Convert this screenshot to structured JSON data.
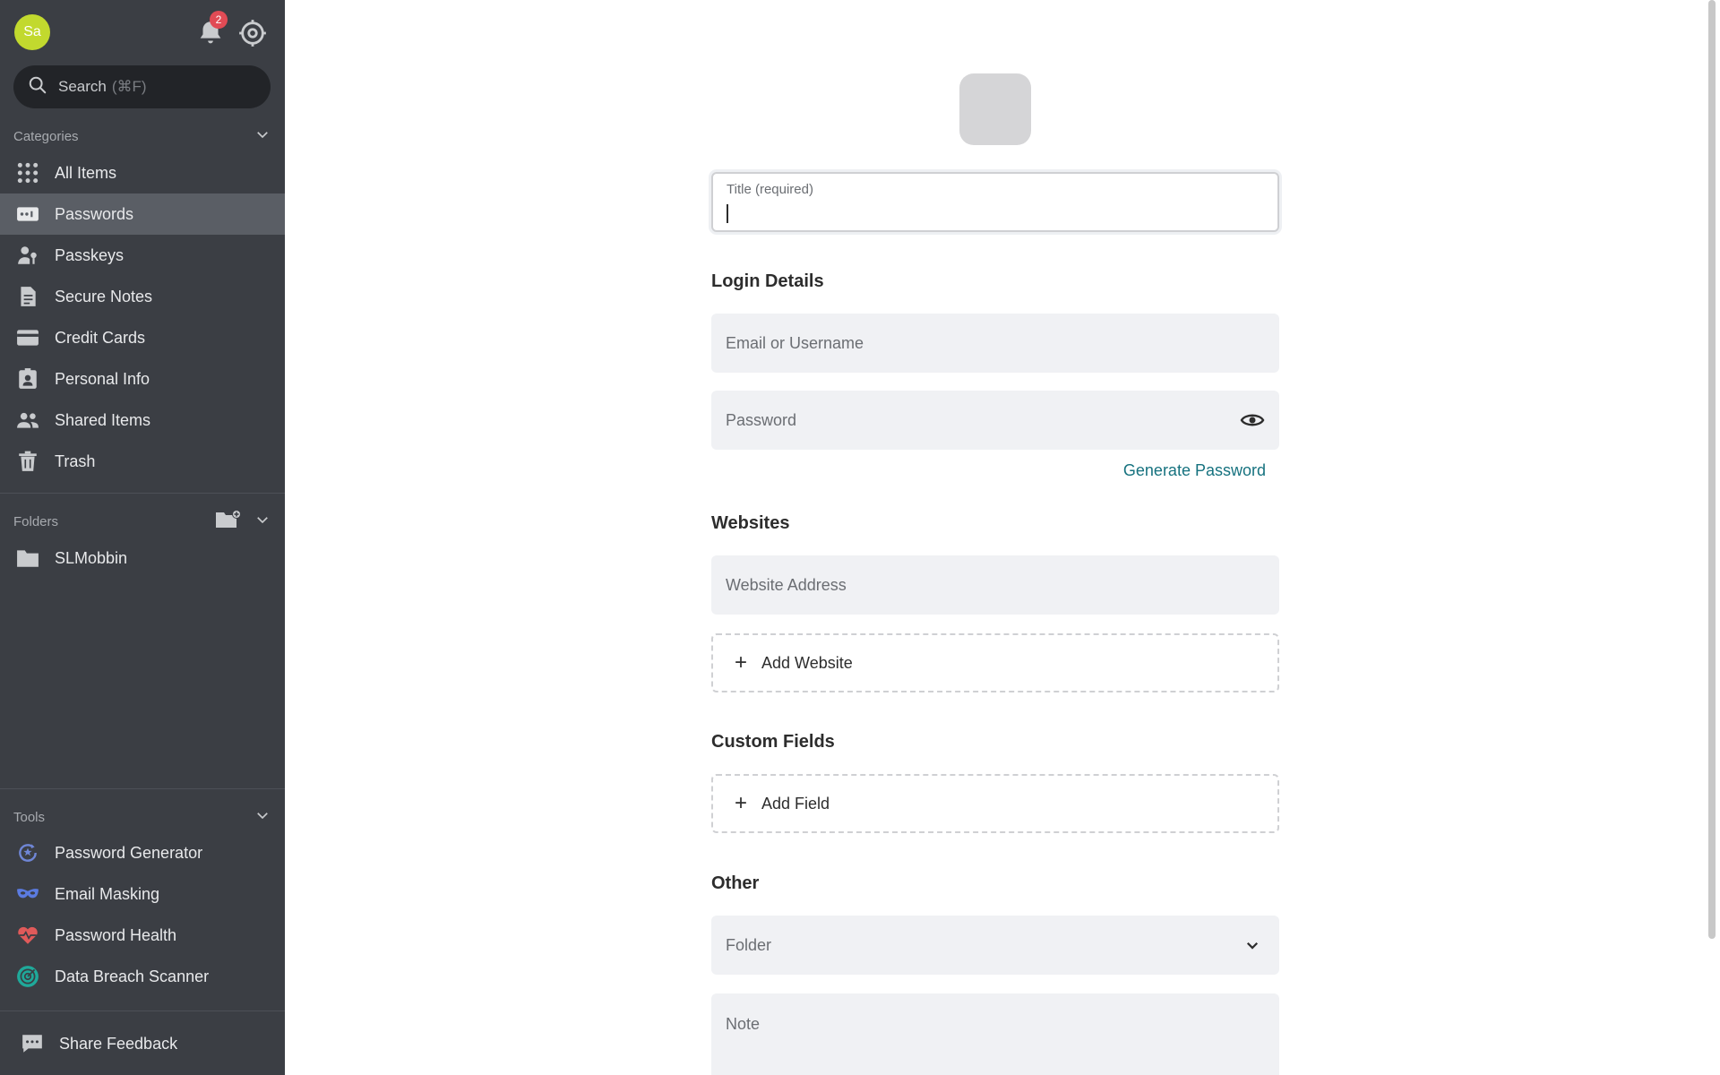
{
  "user": {
    "initials": "Sa",
    "notification_count": "2"
  },
  "search": {
    "placeholder": "Search",
    "shortcut": "(⌘F)"
  },
  "categories": {
    "title": "Categories",
    "items": [
      {
        "label": "All Items",
        "icon": "grid-icon"
      },
      {
        "label": "Passwords",
        "icon": "password-card-icon",
        "active": true
      },
      {
        "label": "Passkeys",
        "icon": "passkey-icon"
      },
      {
        "label": "Secure Notes",
        "icon": "note-icon"
      },
      {
        "label": "Credit Cards",
        "icon": "credit-card-icon"
      },
      {
        "label": "Personal Info",
        "icon": "id-badge-icon"
      },
      {
        "label": "Shared Items",
        "icon": "people-icon"
      },
      {
        "label": "Trash",
        "icon": "trash-icon"
      }
    ]
  },
  "folders": {
    "title": "Folders",
    "items": [
      {
        "label": "SLMobbin",
        "icon": "folder-icon"
      }
    ]
  },
  "tools": {
    "title": "Tools",
    "items": [
      {
        "label": "Password Generator",
        "icon": "password-generator-icon"
      },
      {
        "label": "Email Masking",
        "icon": "mask-icon"
      },
      {
        "label": "Password Health",
        "icon": "heart-pulse-icon"
      },
      {
        "label": "Data Breach Scanner",
        "icon": "radar-icon"
      }
    ]
  },
  "feedback": {
    "label": "Share Feedback"
  },
  "form": {
    "title_label": "Title (required)",
    "login_heading": "Login Details",
    "username_placeholder": "Email or Username",
    "password_placeholder": "Password",
    "generate_label": "Generate Password",
    "websites_heading": "Websites",
    "website_placeholder": "Website Address",
    "add_website_label": "Add Website",
    "custom_heading": "Custom Fields",
    "add_field_label": "Add Field",
    "other_heading": "Other",
    "folder_placeholder": "Folder",
    "note_placeholder": "Note"
  },
  "colors": {
    "accent": "#16727f",
    "sidebar": "#3b3e44",
    "badge": "#e14b55",
    "avatar": "#c2d92e"
  }
}
